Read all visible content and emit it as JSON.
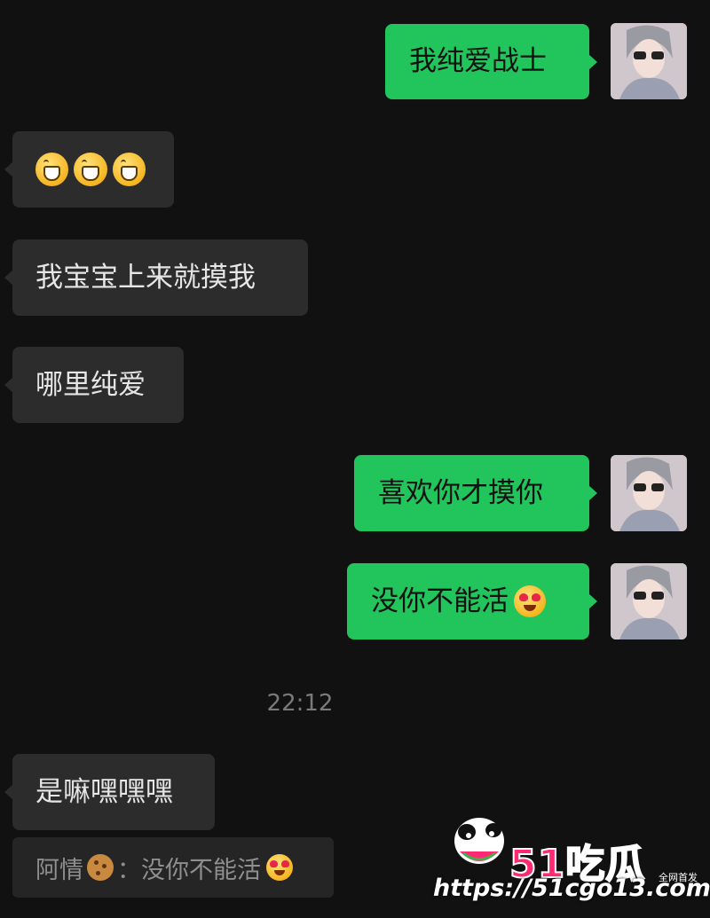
{
  "messages": [
    {
      "id": "m1",
      "side": "out",
      "text": "我纯爱战士"
    },
    {
      "id": "m2",
      "side": "in",
      "emoji": [
        "grinning-face-emoji",
        "grinning-face-emoji",
        "grinning-face-emoji"
      ]
    },
    {
      "id": "m3",
      "side": "in",
      "text": "我宝宝上来就摸我"
    },
    {
      "id": "m4",
      "side": "in",
      "text": "哪里纯爱"
    },
    {
      "id": "m5",
      "side": "out",
      "text": "喜欢你才摸你"
    },
    {
      "id": "m6",
      "side": "out",
      "text": "没你不能活",
      "trailing_emoji": "heart-eyes-emoji"
    },
    {
      "id": "m7",
      "side": "in",
      "text": "是嘛嘿嘿嘿"
    }
  ],
  "timestamp": "22:12",
  "quote": {
    "sender": "阿情",
    "sender_emoji": "cookie-emoji",
    "separator": "：",
    "text": "没你不能活",
    "trailing_emoji": "heart-eyes-emoji"
  },
  "watermark": {
    "brand": "51吃瓜",
    "tag": "全网首发",
    "url": "https://51cgo13.com"
  },
  "colors": {
    "background": "#111111",
    "incoming_bubble": "#2c2c2c",
    "outgoing_bubble": "#21c55b",
    "accent": "#ff2a72"
  }
}
